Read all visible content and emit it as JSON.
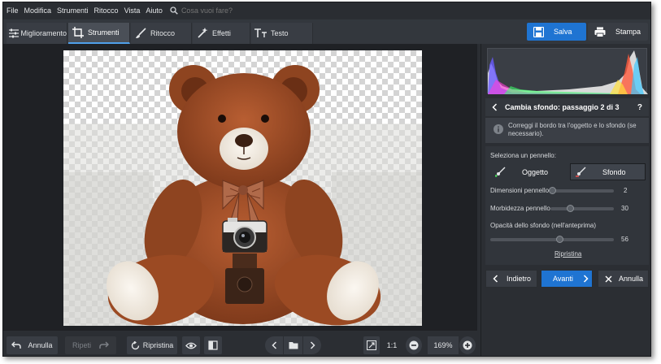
{
  "menu": [
    "File",
    "Modifica",
    "Strumenti",
    "Ritocco",
    "Vista",
    "Aiuto"
  ],
  "search": {
    "placeholder": "Cosa vuoi fare?"
  },
  "tabs": [
    {
      "label": "Miglioramento",
      "icon": "sliders-icon"
    },
    {
      "label": "Strumenti",
      "icon": "crop-icon"
    },
    {
      "label": "Ritocco",
      "icon": "brush-icon"
    },
    {
      "label": "Effetti",
      "icon": "wand-icon"
    },
    {
      "label": "Testo",
      "icon": "text-icon"
    }
  ],
  "active_tab": "Strumenti",
  "actions": {
    "save_label": "Salva",
    "print_label": "Stampa"
  },
  "panel": {
    "step_title": "Cambia sfondo: passaggio 2 di 3",
    "info": "Correggi il bordo tra l'oggetto e lo sfondo (se necessario).",
    "select_brush_label": "Seleziona un pennello:",
    "brush_object": "Oggetto",
    "brush_background": "Sfondo",
    "brush_size_label": "Dimensioni pennello",
    "brush_size_value": "2",
    "softness_label": "Morbidezza pennello",
    "softness_value": "30",
    "opacity_label": "Opacità dello sfondo (nell'anteprima)",
    "opacity_value": "56",
    "reset_label": "Ripristina",
    "back_label": "Indietro",
    "next_label": "Avanti",
    "cancel_label": "Annulla"
  },
  "bottom": {
    "undo_label": "Annulla",
    "redo_label": "Ripeti",
    "reset_label": "Ripristina",
    "fit_label": "1:1",
    "zoom_value": "169%"
  },
  "colors": {
    "accent": "#1f74d2",
    "panel": "#2b2e33",
    "bear": "#a4502a"
  }
}
